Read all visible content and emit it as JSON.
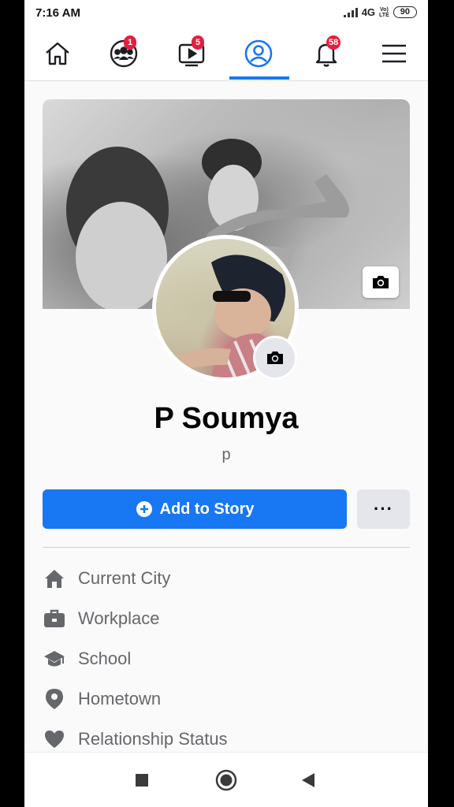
{
  "status_bar": {
    "time": "7:16 AM",
    "network": "4G",
    "volte_top": "Vo)",
    "volte_bottom": "LTE",
    "battery": "90"
  },
  "nav": {
    "items": [
      {
        "icon": "home-icon"
      },
      {
        "icon": "groups-icon",
        "badge": "1"
      },
      {
        "icon": "watch-icon",
        "badge": "5"
      },
      {
        "icon": "profile-icon",
        "active": true
      },
      {
        "icon": "bell-icon",
        "badge": "58"
      },
      {
        "icon": "menu-icon"
      }
    ],
    "accent": "#1877f2",
    "badge_color": "#e41e3f"
  },
  "profile": {
    "name": "P Soumya",
    "bio": "p",
    "add_story_label": "Add to Story",
    "more_label": "···"
  },
  "details": [
    {
      "icon": "home-icon",
      "label": "Current City"
    },
    {
      "icon": "briefcase-icon",
      "label": "Workplace"
    },
    {
      "icon": "graduation-cap-icon",
      "label": "School"
    },
    {
      "icon": "location-pin-icon",
      "label": "Hometown"
    },
    {
      "icon": "heart-icon",
      "label": "Relationship Status"
    }
  ]
}
